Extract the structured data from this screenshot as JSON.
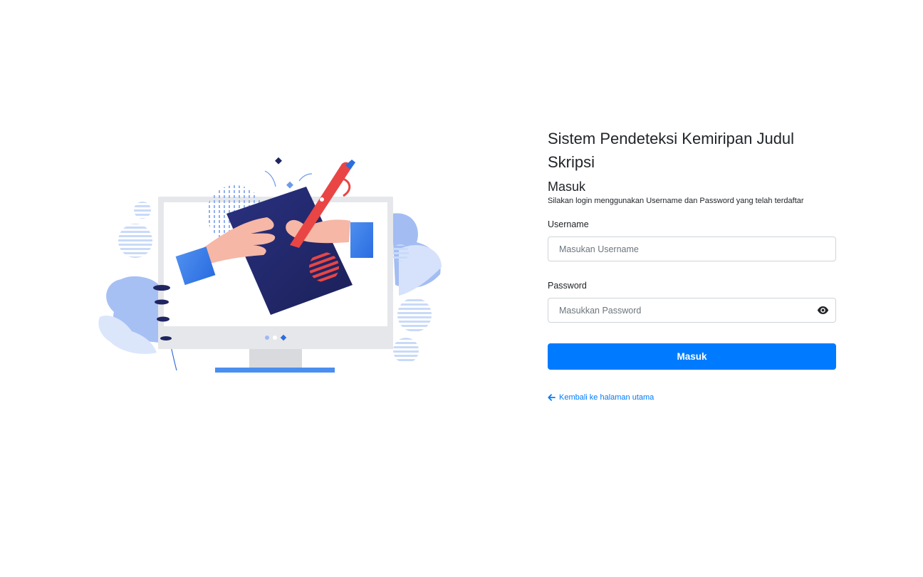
{
  "app": {
    "title": "Sistem Pendeteksi Kemiripan Judul Skripsi"
  },
  "login": {
    "heading": "Masuk",
    "subtitle": "Silakan login menggunakan Username dan Password yang telah terdaftar",
    "username": {
      "label": "Username",
      "placeholder": "Masukan Username",
      "value": ""
    },
    "password": {
      "label": "Password",
      "placeholder": "Masukkan Password",
      "value": "",
      "toggle_icon": "eye-icon"
    },
    "submit_label": "Masuk",
    "back_link": {
      "label": "Kembali ke halaman utama",
      "icon": "arrow-left-icon"
    }
  },
  "illustration": {
    "subject": "hands-drawing-on-monitor-illustration"
  },
  "colors": {
    "primary": "#007bff",
    "navy": "#1f2562",
    "accent_red": "#e94545",
    "light_blue": "#9fb9f3",
    "skin": "#f6b7a6"
  }
}
